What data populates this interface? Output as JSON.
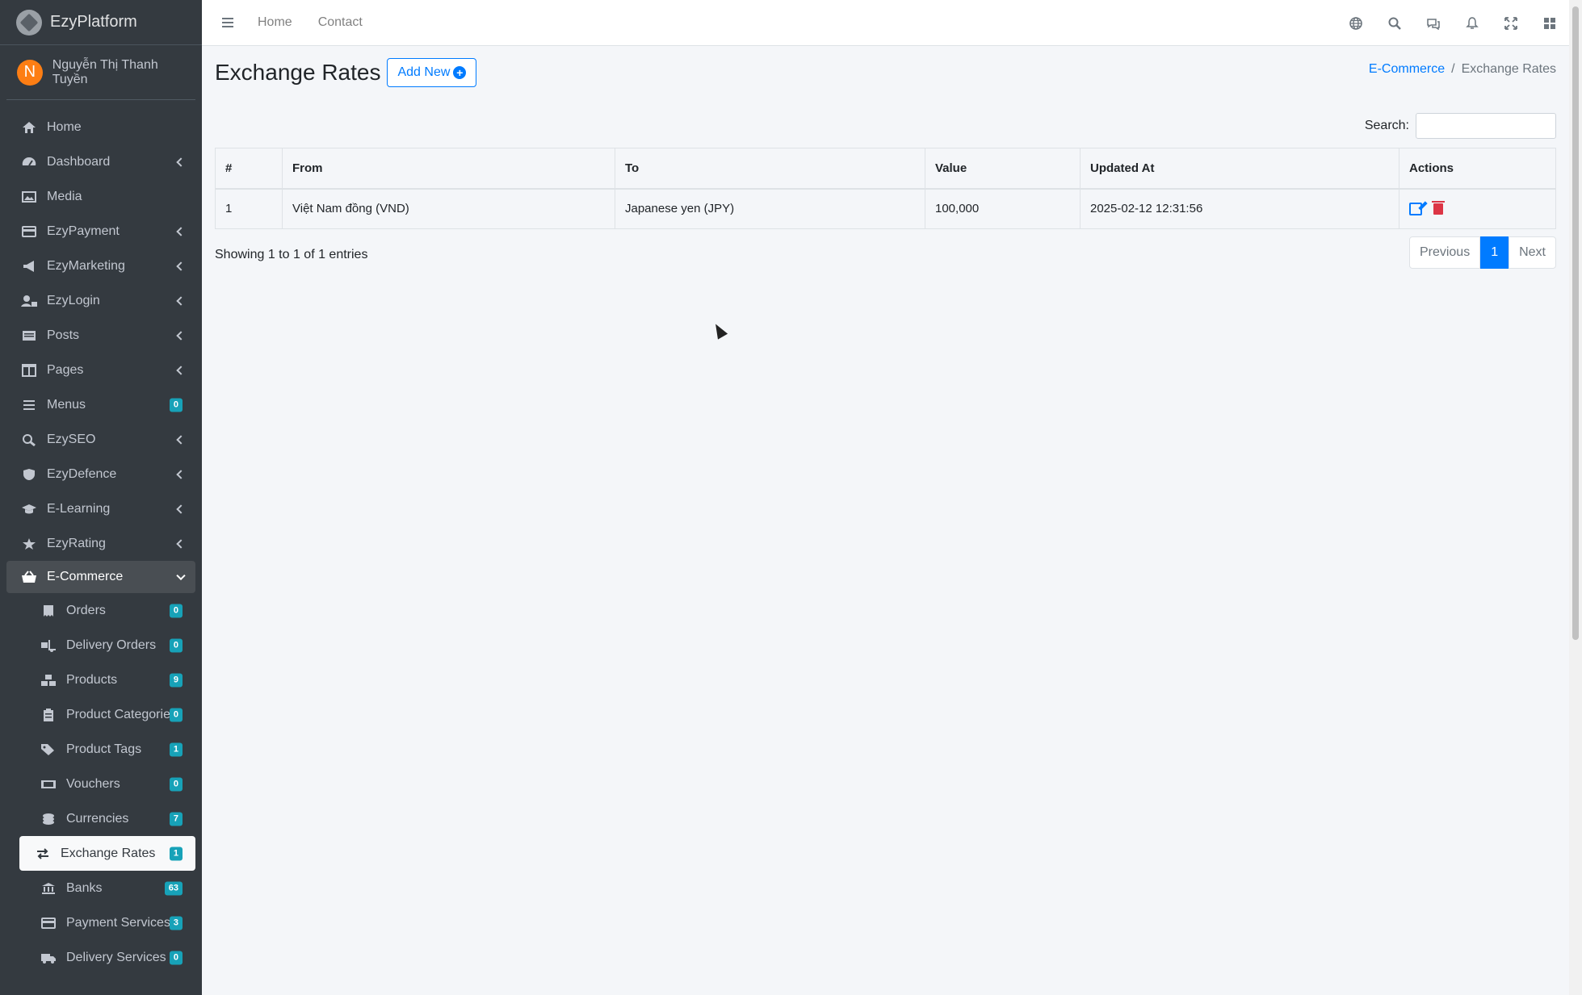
{
  "brand": {
    "name": "EzyPlatform"
  },
  "user": {
    "initial": "N",
    "name": "Nguyễn Thị Thanh Tuyền"
  },
  "sidebar": {
    "items": [
      {
        "label": "Home",
        "icon": "home-icon"
      },
      {
        "label": "Dashboard",
        "icon": "dashboard-icon"
      },
      {
        "label": "Media",
        "icon": "image-icon"
      },
      {
        "label": "EzyPayment",
        "icon": "credit-card-icon"
      },
      {
        "label": "EzyMarketing",
        "icon": "megaphone-icon"
      },
      {
        "label": "EzyLogin",
        "icon": "user-lock-icon"
      },
      {
        "label": "Posts",
        "icon": "newspaper-icon"
      },
      {
        "label": "Pages",
        "icon": "columns-icon"
      },
      {
        "label": "Menus",
        "icon": "bars-icon",
        "badge": "0"
      },
      {
        "label": "EzySEO",
        "icon": "search-plus-icon"
      },
      {
        "label": "EzyDefence",
        "icon": "shield-icon"
      },
      {
        "label": "E-Learning",
        "icon": "graduation-cap-icon"
      },
      {
        "label": "EzyRating",
        "icon": "star-icon"
      },
      {
        "label": "E-Commerce",
        "icon": "basket-icon"
      }
    ],
    "ecommerce_sub": [
      {
        "label": "Orders",
        "badge": "0",
        "icon": "receipt-icon"
      },
      {
        "label": "Delivery Orders",
        "badge": "0",
        "icon": "truck-loading-icon"
      },
      {
        "label": "Products",
        "badge": "9",
        "icon": "boxes-icon"
      },
      {
        "label": "Product Categories",
        "badge": "0",
        "icon": "clipboard-list-icon"
      },
      {
        "label": "Product Tags",
        "badge": "1",
        "icon": "tags-icon"
      },
      {
        "label": "Vouchers",
        "badge": "0",
        "icon": "ticket-icon"
      },
      {
        "label": "Currencies",
        "badge": "7",
        "icon": "coins-icon"
      },
      {
        "label": "Exchange Rates",
        "badge": "1",
        "icon": "exchange-icon"
      },
      {
        "label": "Banks",
        "badge": "63",
        "icon": "bank-icon"
      },
      {
        "label": "Payment Services",
        "badge": "3",
        "icon": "credit-card-icon"
      },
      {
        "label": "Delivery Services",
        "badge": "0",
        "icon": "truck-icon"
      }
    ]
  },
  "topbar": {
    "links": [
      "Home",
      "Contact"
    ]
  },
  "page": {
    "title": "Exchange Rates",
    "add_label": "Add New"
  },
  "breadcrumb": {
    "parent": "E-Commerce",
    "sep": "/",
    "current": "Exchange Rates"
  },
  "search": {
    "label": "Search:",
    "value": ""
  },
  "table": {
    "headers": [
      "#",
      "From",
      "To",
      "Value",
      "Updated At",
      "Actions"
    ],
    "rows": [
      {
        "num": "1",
        "from": "Việt Nam đồng (VND)",
        "to": "Japanese yen (JPY)",
        "value": "100,000",
        "updated": "2025-02-12 12:31:56"
      }
    ]
  },
  "info": "Showing 1 to 1 of 1 entries",
  "pagination": {
    "previous": "Previous",
    "page": "1",
    "next": "Next"
  },
  "colors": {
    "sidebar_bg": "#343a40",
    "primary": "#007bff",
    "badge": "#17a2b8",
    "danger": "#dc3545",
    "avatar": "#fd7e14"
  }
}
